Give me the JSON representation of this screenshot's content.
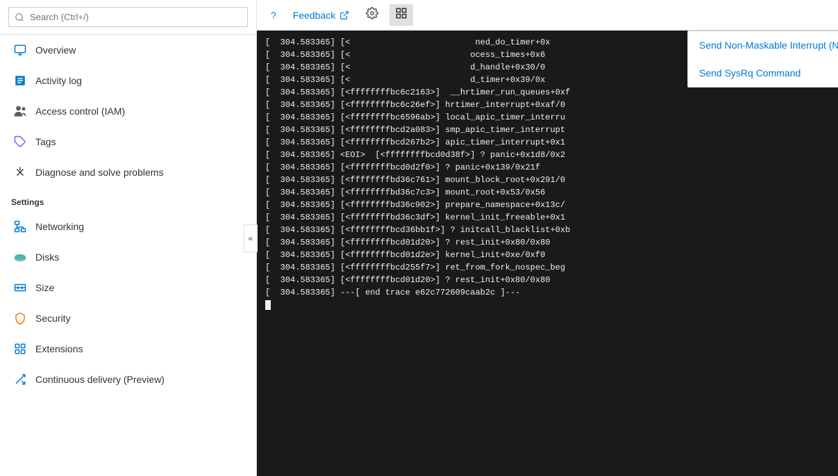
{
  "sidebar": {
    "search_placeholder": "Search (Ctrl+/)",
    "nav_items": [
      {
        "id": "overview",
        "label": "Overview",
        "icon": "monitor"
      },
      {
        "id": "activity-log",
        "label": "Activity log",
        "icon": "list"
      },
      {
        "id": "access-control",
        "label": "Access control (IAM)",
        "icon": "people"
      },
      {
        "id": "tags",
        "label": "Tags",
        "icon": "tag"
      },
      {
        "id": "diagnose",
        "label": "Diagnose and solve problems",
        "icon": "wrench"
      }
    ],
    "settings_label": "Settings",
    "settings_items": [
      {
        "id": "networking",
        "label": "Networking",
        "icon": "networking"
      },
      {
        "id": "disks",
        "label": "Disks",
        "icon": "disks"
      },
      {
        "id": "size",
        "label": "Size",
        "icon": "size"
      },
      {
        "id": "security",
        "label": "Security",
        "icon": "security"
      },
      {
        "id": "extensions",
        "label": "Extensions",
        "icon": "extensions"
      },
      {
        "id": "continuous-delivery",
        "label": "Continuous delivery (Preview)",
        "icon": "delivery"
      }
    ]
  },
  "toolbar": {
    "help_label": "?",
    "feedback_label": "Feedback",
    "settings_icon": "gear",
    "grid_icon": "grid"
  },
  "dropdown": {
    "items": [
      {
        "id": "nmi",
        "label": "Send Non-Maskable Interrupt (NMI)"
      },
      {
        "id": "sysrq",
        "label": "Send SysRq Command"
      }
    ]
  },
  "terminal": {
    "lines": [
      "[  304.583365] [<                         ned_do_timer+0x",
      "[  304.583365] [<                        ocess_times+0x6",
      "[  304.583365] [<                        d_handle+0x30/0",
      "[  304.583365] [<                        d_timer+0x39/0x",
      "[  304.583365] [<ffffffffbc6c2163>]  __hrtimer_run_queues+0xf",
      "[  304.583365] [<ffffffffbc6c26ef>] hrtimer_interrupt+0xaf/0",
      "[  304.583365] [<ffffffffbc6596ab>] local_apic_timer_interru",
      "[  304.583365] [<ffffffffbcd2a083>] smp_apic_timer_interrupt",
      "[  304.583365] [<ffffffffbcd267b2>] apic_timer_interrupt+0x1",
      "[  304.583365] <EOI>  [<ffffffffbcd0d38f>] ? panic+0x1d8/0x2",
      "[  304.583365] [<ffffffffbcd0d2f0>] ? panic+0x139/0x21f",
      "[  304.583365] [<ffffffffbd36c761>] mount_block_root+0x291/0",
      "[  304.583365] [<ffffffffbd36c7c3>] mount_root+0x53/0x56",
      "[  304.583365] [<ffffffffbd36c902>] prepare_namespace+0x13c/",
      "[  304.583365] [<ffffffffbd36c3df>] kernel_init_freeable+0x1",
      "[  304.583365] [<ffffffffbcd36bb1f>] ? initcall_blacklist+0xb",
      "[  304.583365] [<ffffffffbcd01d20>] ? rest_init+0x80/0x80",
      "[  304.583365] [<ffffffffbcd01d2e>] kernel_init+0xe/0xf0",
      "[  304.583365] [<ffffffffbcd255f7>] ret_from_fork_nospec_beg",
      "[  304.583365] [<ffffffffbcd01d20>] ? rest_init+0x80/0x80",
      "[  304.583365] ---[ end trace e62c772609caab2c ]---"
    ]
  }
}
